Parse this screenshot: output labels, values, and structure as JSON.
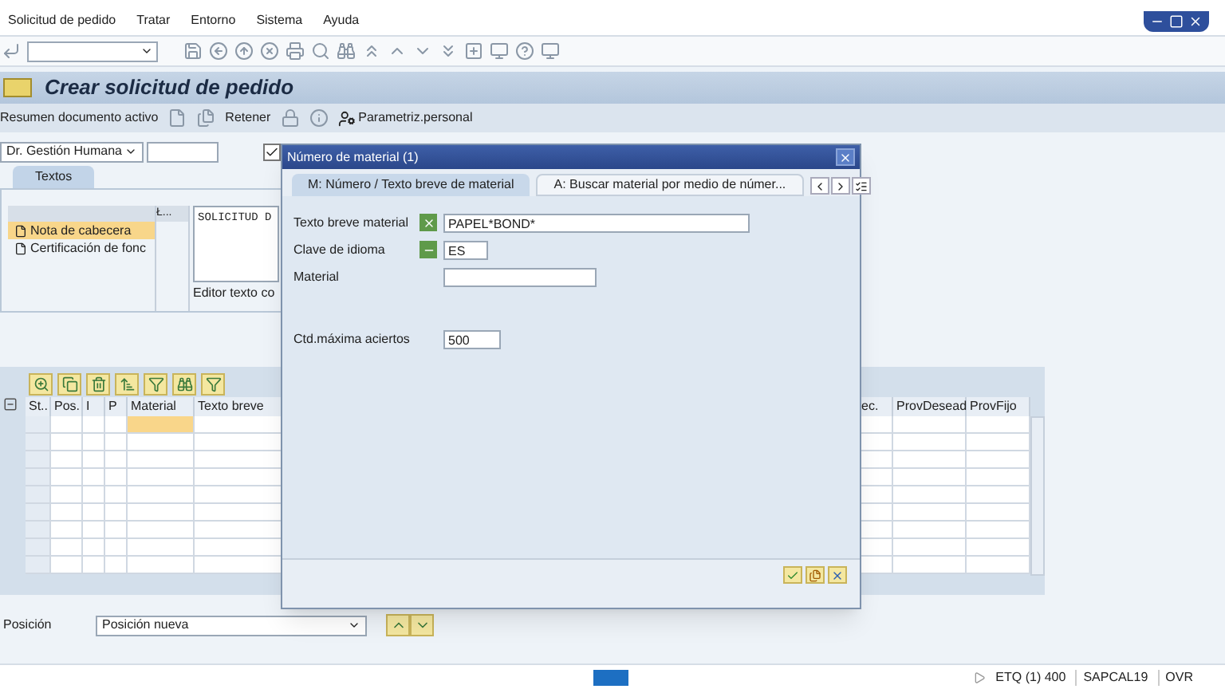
{
  "menu_bar": {
    "items": [
      "Solicitud de pedido",
      "Tratar",
      "Entorno",
      "Sistema",
      "Ayuda"
    ]
  },
  "title": "Crear solicitud de pedido",
  "app_toolbar": {
    "summary": "Resumen documento activo",
    "hold": "Retener",
    "personal_settings": "Parametriz.personal"
  },
  "header_row": {
    "organization": "Dr. Gestión Humana",
    "checkbox_checked": true
  },
  "texts_panel": {
    "tab": {
      "label": "Textos",
      "selected": true
    },
    "tree": [
      {
        "label": "Nota de cabecera",
        "selected": true
      },
      {
        "label": "Certificación de fonc",
        "selected": false
      }
    ],
    "column_header": "Ł...",
    "editor_text": "SOLICITUD D",
    "editor_label": "Editor texto co"
  },
  "items_table": {
    "columns_left": [
      "St..",
      "Pos.",
      "I",
      "P",
      "Material",
      "Texto breve"
    ],
    "columns_right": [
      "ec.",
      "ProvDesead",
      "ProvFijo"
    ],
    "rows": [
      {
        "focused": true
      },
      {
        "focused": false
      },
      {
        "focused": false
      },
      {
        "focused": false
      },
      {
        "focused": false
      },
      {
        "focused": false
      },
      {
        "focused": false
      },
      {
        "focused": false
      },
      {
        "focused": false
      }
    ]
  },
  "position_row": {
    "label": "Posición",
    "value": "Posición nueva"
  },
  "status_bar": {
    "client": "ETQ (1) 400",
    "server": "SAPCAL19",
    "mode": "OVR"
  },
  "dialog": {
    "title": "Número de material (1)",
    "tabs": [
      {
        "label": "M: Número / Texto breve de material",
        "selected": true
      },
      {
        "label": "A: Buscar material por medio de númer...",
        "selected": false
      }
    ],
    "fields": [
      {
        "label": "Texto breve material",
        "kind": "pattern",
        "value": "PAPEL*BOND*"
      },
      {
        "label": "Clave de idioma",
        "kind": "equal",
        "value": "ES"
      },
      {
        "label": "Material",
        "kind": "plain"
      }
    ],
    "limit_field": {
      "label": "Ctd.máxima aciertos",
      "value": "500"
    }
  }
}
